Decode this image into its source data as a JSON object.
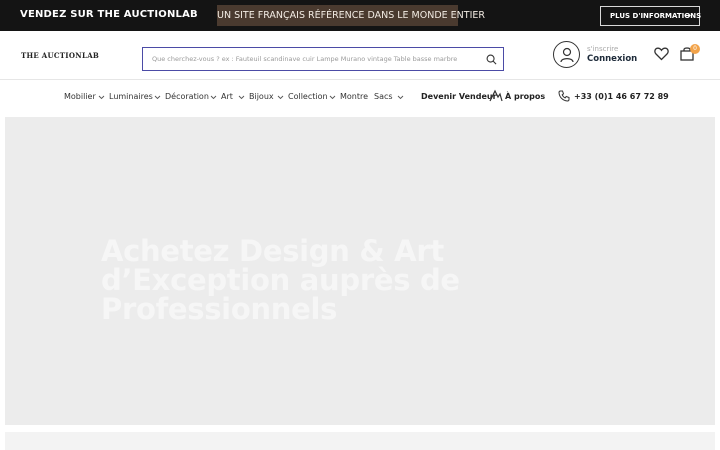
{
  "topbar": {
    "sell_label": "VENDEZ SUR THE AUCTIONLAB",
    "promo_text": "UN SITE FRANÇAIS RÉFÉRENCE DANS LE MONDE ENTIER",
    "info_button": "PLUS D'INFORMATIONS",
    "info_arrow": "→"
  },
  "header": {
    "logo": "THE AUCTIONLAB",
    "search": {
      "placeholder": "Que cherchez-vous ? ex : Fauteuil scandinave cuir    Lampe Murano vintage    Table basse marbre",
      "icon": "search-icon"
    },
    "account": {
      "signup": "s'inscrire",
      "login": "Connexion"
    },
    "cart_count": "0",
    "colors": {
      "badge": "#f2a34a",
      "search_border": "#4b4ba6"
    }
  },
  "nav": {
    "items": [
      {
        "label": "Mobilier"
      },
      {
        "label": "Luminaires"
      },
      {
        "label": "Décoration"
      },
      {
        "label": "Art"
      },
      {
        "label": "Bijoux"
      },
      {
        "label": "Collection"
      },
      {
        "label": "Montre"
      },
      {
        "label": "Sacs"
      }
    ],
    "become_seller": "Devenir Vendeur",
    "about": "À propos",
    "phone": "+33 (0)1 46 67 72 89"
  },
  "hero": {
    "title": "Achetez Design & Art d’Exception auprès de Professionnels"
  }
}
